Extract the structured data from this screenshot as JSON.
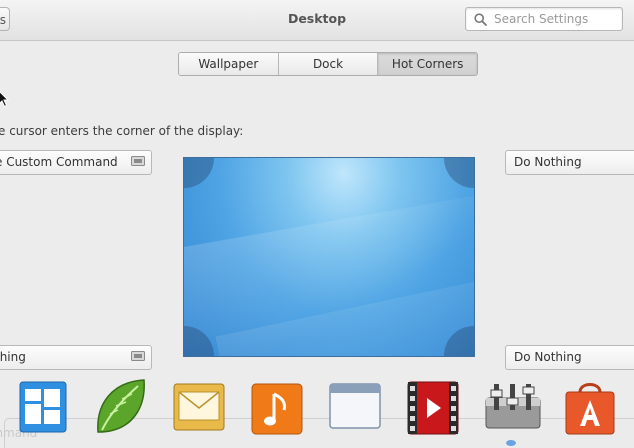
{
  "header": {
    "back_label": "s",
    "title": "Desktop",
    "search_placeholder": "Search Settings"
  },
  "tabs": [
    {
      "label": "Wallpaper",
      "active": false
    },
    {
      "label": "Dock",
      "active": false
    },
    {
      "label": "Hot Corners",
      "active": true
    }
  ],
  "hot_corners": {
    "instruction": "e cursor enters the corner of the display:",
    "top_left": "e Custom Command",
    "top_right": "Do Nothing",
    "bottom_left": "thing",
    "bottom_right": "Do Nothing"
  },
  "dock": {
    "partial_text": "ommand",
    "apps": [
      {
        "icon": "multitasking-view-icon",
        "color": "#2f8fe0"
      },
      {
        "icon": "midori-leaf-icon",
        "color": "#5aa52a"
      },
      {
        "icon": "mail-envelope-icon",
        "color": "#e9b94a"
      },
      {
        "icon": "music-note-icon",
        "color": "#f07a18"
      },
      {
        "icon": "files-window-icon",
        "color": "#8aa0b8"
      },
      {
        "icon": "video-player-icon",
        "color": "#c8181b"
      },
      {
        "icon": "settings-sliders-icon",
        "color": "#8a8a8a"
      },
      {
        "icon": "app-center-bag-icon",
        "color": "#e8582a"
      }
    ]
  }
}
